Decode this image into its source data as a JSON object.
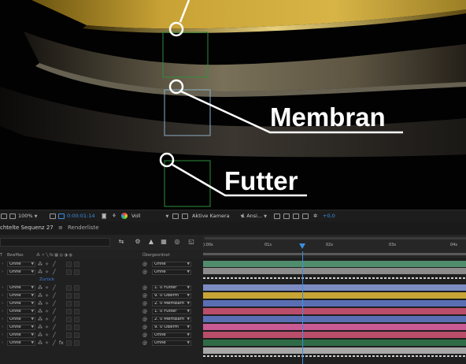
{
  "viewer": {
    "callout_membran": "Membran",
    "callout_futter": "Futter"
  },
  "toolbar": {
    "zoom": "100%",
    "timecode": "0:00:01:14",
    "resolution": "Voll",
    "camera": "Aktive Kamera",
    "views": "1 Ansi...",
    "exposure": "+0,0"
  },
  "tabs": {
    "comp": "chtelte Sequenz 27",
    "renderqueue": "Renderliste"
  },
  "columns": {
    "t": "T",
    "trkmat": "BewMas",
    "parent": "Übergeordnet"
  },
  "back_label": "Zurück",
  "layers": [
    {
      "trkmat": "Ohne",
      "fx": false,
      "parent": "Ohne"
    },
    {
      "trkmat": "Ohne",
      "fx": false,
      "parent": "Ohne"
    },
    {
      "trkmat": "Ohne",
      "fx": false,
      "parent": "1. 0 Futter"
    },
    {
      "trkmat": "Ohne",
      "fx": false,
      "parent": "9. 0 Oberm"
    },
    {
      "trkmat": "Ohne",
      "fx": false,
      "parent": "2. 0 Membarn"
    },
    {
      "trkmat": "Ohne",
      "fx": false,
      "parent": "1. 0 Futter"
    },
    {
      "trkmat": "Ohne",
      "fx": false,
      "parent": "2. 0 Membarn"
    },
    {
      "trkmat": "Ohne",
      "fx": false,
      "parent": "9. 0 Oberm"
    },
    {
      "trkmat": "Ohne",
      "fx": false,
      "parent": "Ohne"
    },
    {
      "trkmat": "Ohne",
      "fx": true,
      "parent": "Ohne"
    }
  ],
  "ruler_ticks": [
    "):00s",
    "01s",
    "02s",
    "03s",
    "04s"
  ],
  "bar_colors": [
    "#4f8d6d",
    "#8c8c8c",
    "#7c8cc2",
    "#c8a437",
    "#5a6fb3",
    "#b94d6a",
    "#5a6fb3",
    "#c85a94",
    "#b94d6a",
    "#2f6b47",
    "#a8a8a8"
  ],
  "accent_color": "#3b8fe0"
}
